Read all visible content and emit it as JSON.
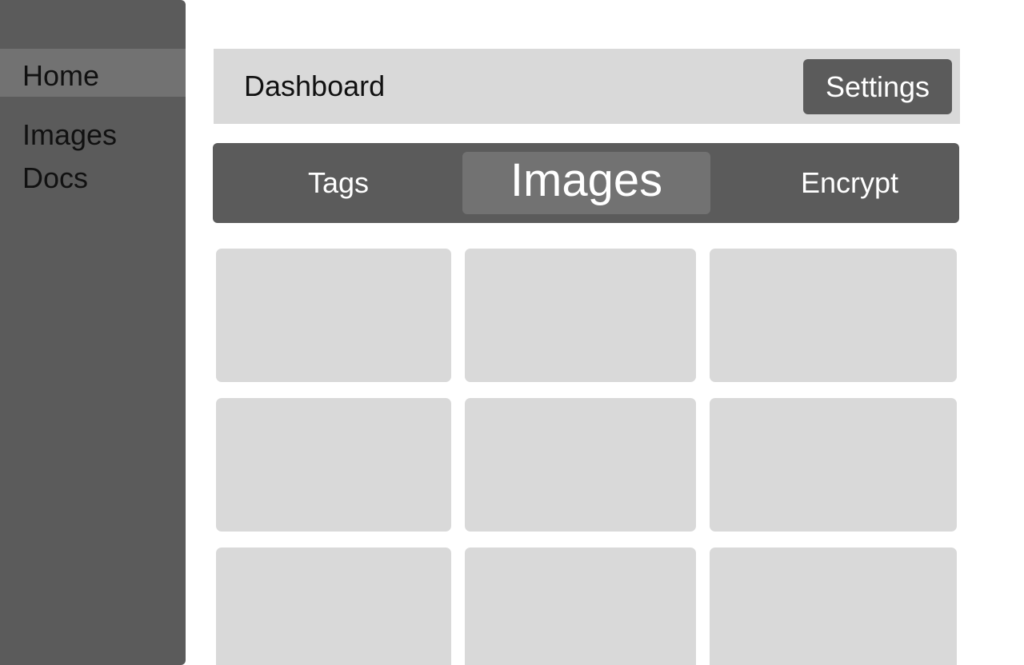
{
  "sidebar": {
    "items": [
      {
        "label": "Home",
        "active": true
      },
      {
        "label": "Images",
        "active": false
      },
      {
        "label": "Docs",
        "active": false
      }
    ]
  },
  "header": {
    "title": "Dashboard",
    "settings_label": "Settings"
  },
  "tabs": [
    {
      "label": "Tags",
      "active": false
    },
    {
      "label": "Images",
      "active": true
    },
    {
      "label": "Encrypt",
      "active": false
    }
  ],
  "grid": {
    "rows": 3,
    "columns": 3
  },
  "colors": {
    "sidebar_bg": "#5b5b5b",
    "active_item_bg": "#727272",
    "panel_bg": "#d9d9d9",
    "button_bg": "#5b5b5b",
    "text_dark": "#111111",
    "text_light": "#ffffff"
  }
}
